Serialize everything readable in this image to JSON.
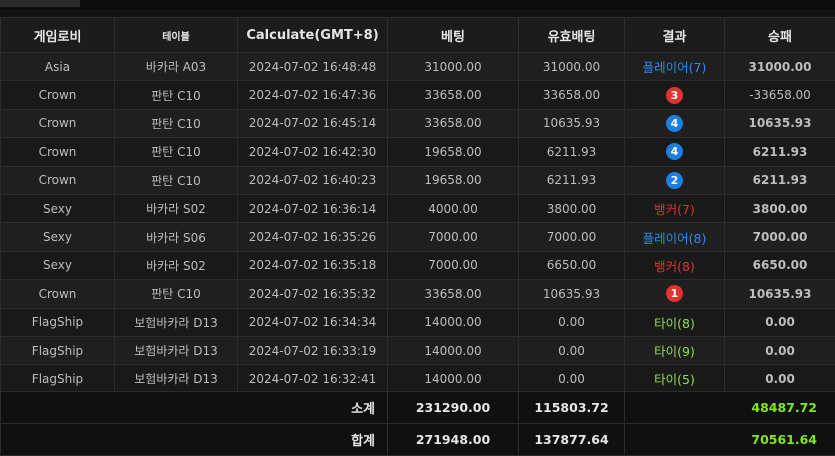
{
  "headers": {
    "game_lobby": "게임로비",
    "table": "테이블",
    "calculate": "Calculate(GMT+8)",
    "bet": "베팅",
    "valid_bet": "유효배팅",
    "result": "결과",
    "win_loss": "승패"
  },
  "rows": [
    {
      "game": "Asia",
      "table": "바카라 A03",
      "time": "2024-07-02 16:48:48",
      "bet": "31000.00",
      "valid_bet": "31000.00",
      "result": {
        "type": "text",
        "text": "플레이어(7)",
        "color": "blue"
      },
      "winloss": "31000.00",
      "winloss_color": "green"
    },
    {
      "game": "Crown",
      "table": "판탄 C10",
      "time": "2024-07-02 16:47:36",
      "bet": "33658.00",
      "valid_bet": "33658.00",
      "result": {
        "type": "badge",
        "text": "3",
        "color": "red"
      },
      "winloss": "-33658.00",
      "winloss_color": "red"
    },
    {
      "game": "Crown",
      "table": "판탄 C10",
      "time": "2024-07-02 16:45:14",
      "bet": "33658.00",
      "valid_bet": "10635.93",
      "result": {
        "type": "badge",
        "text": "4",
        "color": "blue"
      },
      "winloss": "10635.93",
      "winloss_color": "green"
    },
    {
      "game": "Crown",
      "table": "판탄 C10",
      "time": "2024-07-02 16:42:30",
      "bet": "19658.00",
      "valid_bet": "6211.93",
      "result": {
        "type": "badge",
        "text": "4",
        "color": "blue"
      },
      "winloss": "6211.93",
      "winloss_color": "green"
    },
    {
      "game": "Crown",
      "table": "판탄 C10",
      "time": "2024-07-02 16:40:23",
      "bet": "19658.00",
      "valid_bet": "6211.93",
      "result": {
        "type": "badge",
        "text": "2",
        "color": "blue"
      },
      "winloss": "6211.93",
      "winloss_color": "green"
    },
    {
      "game": "Sexy",
      "table": "바카라 S02",
      "time": "2024-07-02 16:36:14",
      "bet": "4000.00",
      "valid_bet": "3800.00",
      "result": {
        "type": "text",
        "text": "뱅커(7)",
        "color": "red"
      },
      "winloss": "3800.00",
      "winloss_color": "green"
    },
    {
      "game": "Sexy",
      "table": "바카라 S06",
      "time": "2024-07-02 16:35:26",
      "bet": "7000.00",
      "valid_bet": "7000.00",
      "result": {
        "type": "text",
        "text": "플레이어(8)",
        "color": "blue"
      },
      "winloss": "7000.00",
      "winloss_color": "green"
    },
    {
      "game": "Sexy",
      "table": "바카라 S02",
      "time": "2024-07-02 16:35:18",
      "bet": "7000.00",
      "valid_bet": "6650.00",
      "result": {
        "type": "text",
        "text": "뱅커(8)",
        "color": "red"
      },
      "winloss": "6650.00",
      "winloss_color": "green"
    },
    {
      "game": "Crown",
      "table": "판탄 C10",
      "time": "2024-07-02 16:35:32",
      "bet": "33658.00",
      "valid_bet": "10635.93",
      "result": {
        "type": "badge",
        "text": "1",
        "color": "red"
      },
      "winloss": "10635.93",
      "winloss_color": "green"
    },
    {
      "game": "FlagShip",
      "table": "보험바카라 D13",
      "time": "2024-07-02 16:34:34",
      "bet": "14000.00",
      "valid_bet": "0.00",
      "result": {
        "type": "text",
        "text": "타이(8)",
        "color": "green"
      },
      "winloss": "0.00",
      "winloss_color": "green"
    },
    {
      "game": "FlagShip",
      "table": "보험바카라 D13",
      "time": "2024-07-02 16:33:19",
      "bet": "14000.00",
      "valid_bet": "0.00",
      "result": {
        "type": "text",
        "text": "타이(9)",
        "color": "green"
      },
      "winloss": "0.00",
      "winloss_color": "green"
    },
    {
      "game": "FlagShip",
      "table": "보험바카라 D13",
      "time": "2024-07-02 16:32:41",
      "bet": "14000.00",
      "valid_bet": "0.00",
      "result": {
        "type": "text",
        "text": "타이(5)",
        "color": "green"
      },
      "winloss": "0.00",
      "winloss_color": "green"
    }
  ],
  "subtotal": {
    "label": "소계",
    "bet": "231290.00",
    "valid_bet": "115803.72",
    "winloss": "48487.72"
  },
  "total": {
    "label": "합계",
    "bet": "271948.00",
    "valid_bet": "137877.64",
    "winloss": "70561.64"
  }
}
